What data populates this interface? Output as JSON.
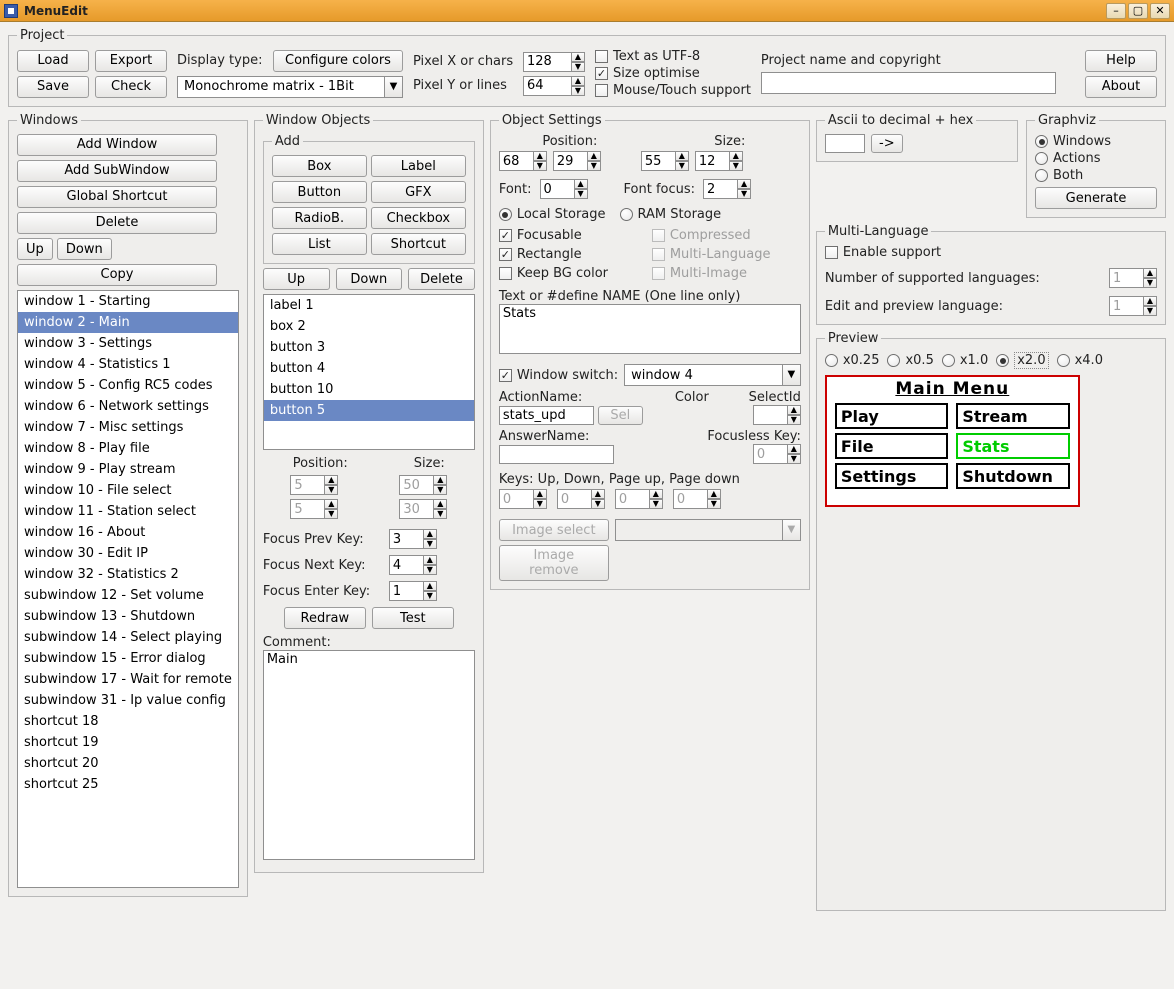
{
  "title": "MenuEdit",
  "project": {
    "legend": "Project",
    "load": "Load",
    "export": "Export",
    "save": "Save",
    "check": "Check",
    "displayTypeLabel": "Display type:",
    "configColors": "Configure colors",
    "displayType": "Monochrome matrix - 1Bit",
    "pixelXLabel": "Pixel X or chars",
    "pixelX": "128",
    "pixelYLabel": "Pixel Y or lines",
    "pixelY": "64",
    "textUtf8": "Text as UTF-8",
    "sizeOpt": "Size optimise",
    "mouse": "Mouse/Touch support",
    "projNameLabel": "Project name and copyright",
    "projName": "",
    "help": "Help",
    "about": "About"
  },
  "windows": {
    "legend": "Windows",
    "addWindow": "Add Window",
    "addSub": "Add SubWindow",
    "globalShortcut": "Global Shortcut",
    "delete": "Delete",
    "up": "Up",
    "down": "Down",
    "copy": "Copy",
    "items": [
      "window 1 - Starting",
      "window 2 - Main",
      "window 3 - Settings",
      "window 4 - Statistics 1",
      "window 5 - Config RC5 codes",
      "window 6 - Network settings",
      "window 7 - Misc settings",
      "window 8 - Play file",
      "window 9 - Play stream",
      "window 10 - File select",
      "window 11 - Station select",
      "window 16 - About",
      "window 30 - Edit IP",
      "window 32 - Statistics 2",
      "subwindow 12 - Set volume",
      "subwindow 13 - Shutdown",
      "subwindow 14 - Select playing",
      "subwindow 15 - Error dialog",
      "subwindow 17 - Wait for remote",
      "subwindow 31 - Ip value config",
      "shortcut 18",
      "shortcut 19",
      "shortcut 20",
      "shortcut 25"
    ],
    "sel": 1
  },
  "wobj": {
    "legend": "Window Objects",
    "addLegend": "Add",
    "box": "Box",
    "label": "Label",
    "button": "Button",
    "gfx": "GFX",
    "radio": "RadioB.",
    "checkbox": "Checkbox",
    "list": "List",
    "shortcut": "Shortcut",
    "up": "Up",
    "down": "Down",
    "delete": "Delete",
    "items": [
      "label 1",
      "box 2",
      "button 3",
      "button 4",
      "button 10",
      "button 5"
    ],
    "sel": 5,
    "positionLabel": "Position:",
    "sizeLabel": "Size:",
    "posX": "5",
    "posY": "5",
    "sizeW": "50",
    "sizeH": "30",
    "focusPrev": "Focus Prev Key:",
    "focusPrevV": "3",
    "focusNext": "Focus Next Key:",
    "focusNextV": "4",
    "focusEnter": "Focus Enter Key:",
    "focusEnterV": "1",
    "redraw": "Redraw",
    "test": "Test",
    "commentLabel": "Comment:",
    "comment": "Main"
  },
  "objset": {
    "legend": "Object Settings",
    "positionLabel": "Position:",
    "sizeLabel": "Size:",
    "posX": "68",
    "posY": "29",
    "sizeW": "55",
    "sizeH": "12",
    "fontLabel": "Font:",
    "font": "0",
    "fontFocusLabel": "Font focus:",
    "fontFocus": "2",
    "localStorage": "Local Storage",
    "ramStorage": "RAM Storage",
    "focusable": "Focusable",
    "compressed": "Compressed",
    "rectangle": "Rectangle",
    "multiLang": "Multi-Language",
    "keepBg": "Keep BG color",
    "multiImage": "Multi-Image",
    "textDefine": "Text or #define NAME (One line only)",
    "text": "Stats",
    "windowSwitch": "Window switch:",
    "windowSwitchV": "window 4",
    "actionName": "ActionName:",
    "actionNameV": "stats_upd",
    "color": "Color",
    "sel": "Sel",
    "selectId": "SelectId",
    "selectIdV": "",
    "answerName": "AnswerName:",
    "answerNameV": "",
    "focuslessKey": "Focusless Key:",
    "focuslessKeyV": "0",
    "keys": "Keys: Up, Down, Page up, Page down",
    "k1": "0",
    "k2": "0",
    "k3": "0",
    "k4": "0",
    "imgSelect": "Image select",
    "imgRemove": "Image remove"
  },
  "ascii": {
    "legend": "Ascii to decimal + hex",
    "btn": "->"
  },
  "graphviz": {
    "legend": "Graphviz",
    "windows": "Windows",
    "actions": "Actions",
    "both": "Both",
    "generate": "Generate"
  },
  "multilang": {
    "legend": "Multi-Language",
    "enable": "Enable support",
    "numLang": "Number of supported languages:",
    "numLangV": "1",
    "editLang": "Edit and preview language:",
    "editLangV": "1"
  },
  "preview": {
    "legend": "Preview",
    "zoom025": "x0.25",
    "zoom05": "x0.5",
    "zoom10": "x1.0",
    "zoom20": "x2.0",
    "zoom40": "x4.0",
    "title": "Main Menu",
    "cells": [
      "Play",
      "Stream",
      "File",
      "Stats",
      "Settings",
      "Shutdown"
    ],
    "highlight": 3
  }
}
